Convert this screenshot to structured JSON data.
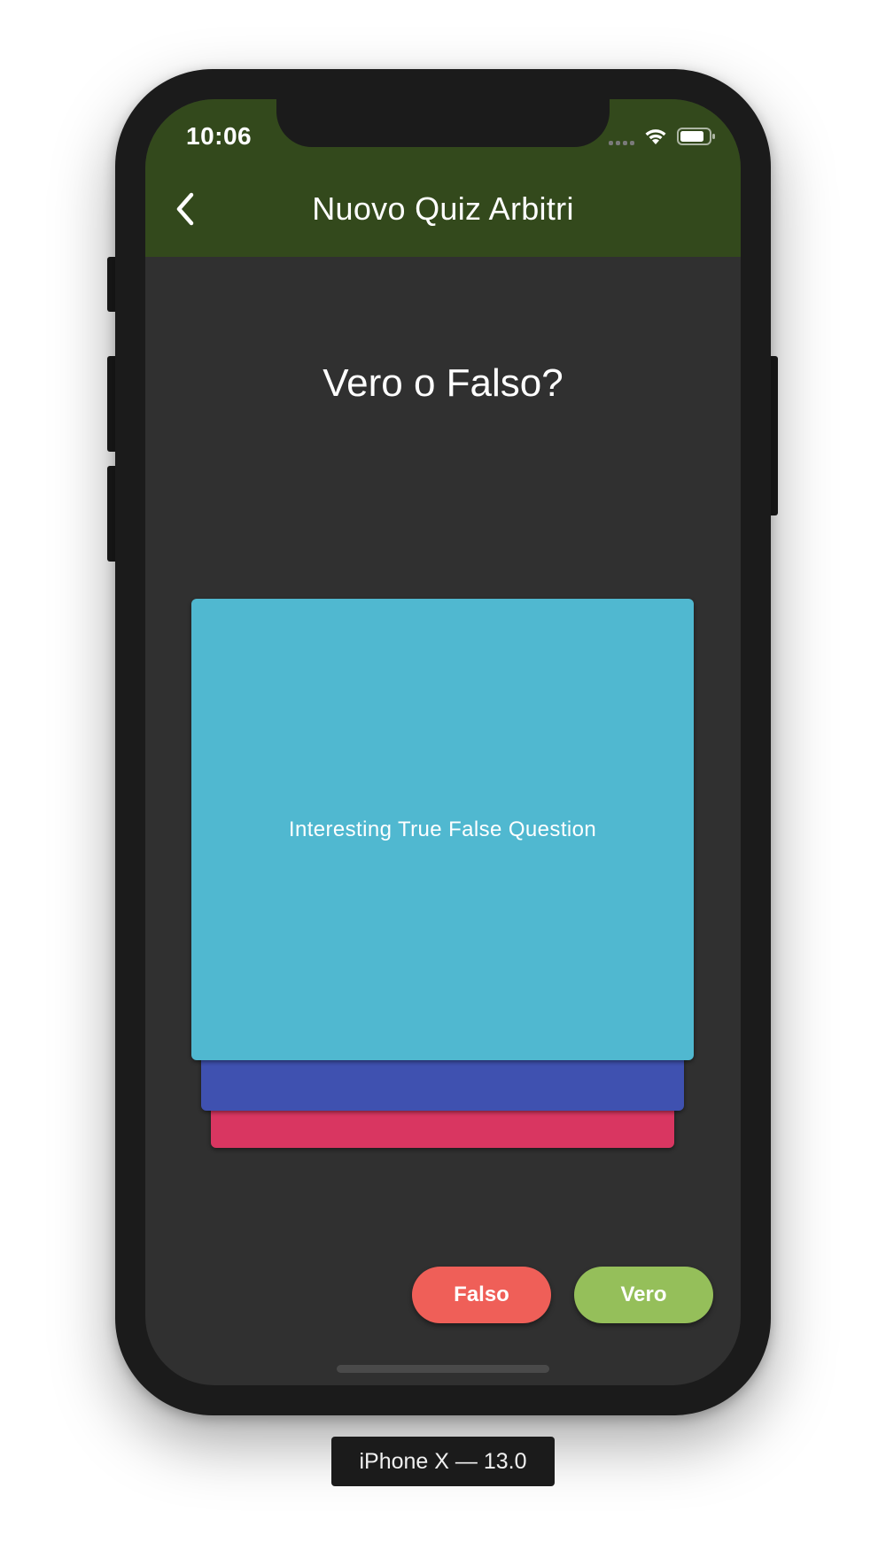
{
  "status_bar": {
    "time": "10:06",
    "icons": [
      "signal-icon",
      "wifi-icon",
      "battery-icon"
    ]
  },
  "app_bar": {
    "title": "Nuovo Quiz Arbitri",
    "back_icon": "chevron-left-icon",
    "color": "#33491c"
  },
  "main": {
    "heading": "Vero o Falso?",
    "cards": {
      "front_text": "Interesting True False Question",
      "front_color": "#50b8d0",
      "middle_color": "#3f51b0",
      "back_color": "#d93661"
    }
  },
  "actions": {
    "false_label": "Falso",
    "true_label": "Vero",
    "false_color": "#ef5f58",
    "true_color": "#95bf5a"
  },
  "device": {
    "label": "iPhone X — 13.0"
  }
}
